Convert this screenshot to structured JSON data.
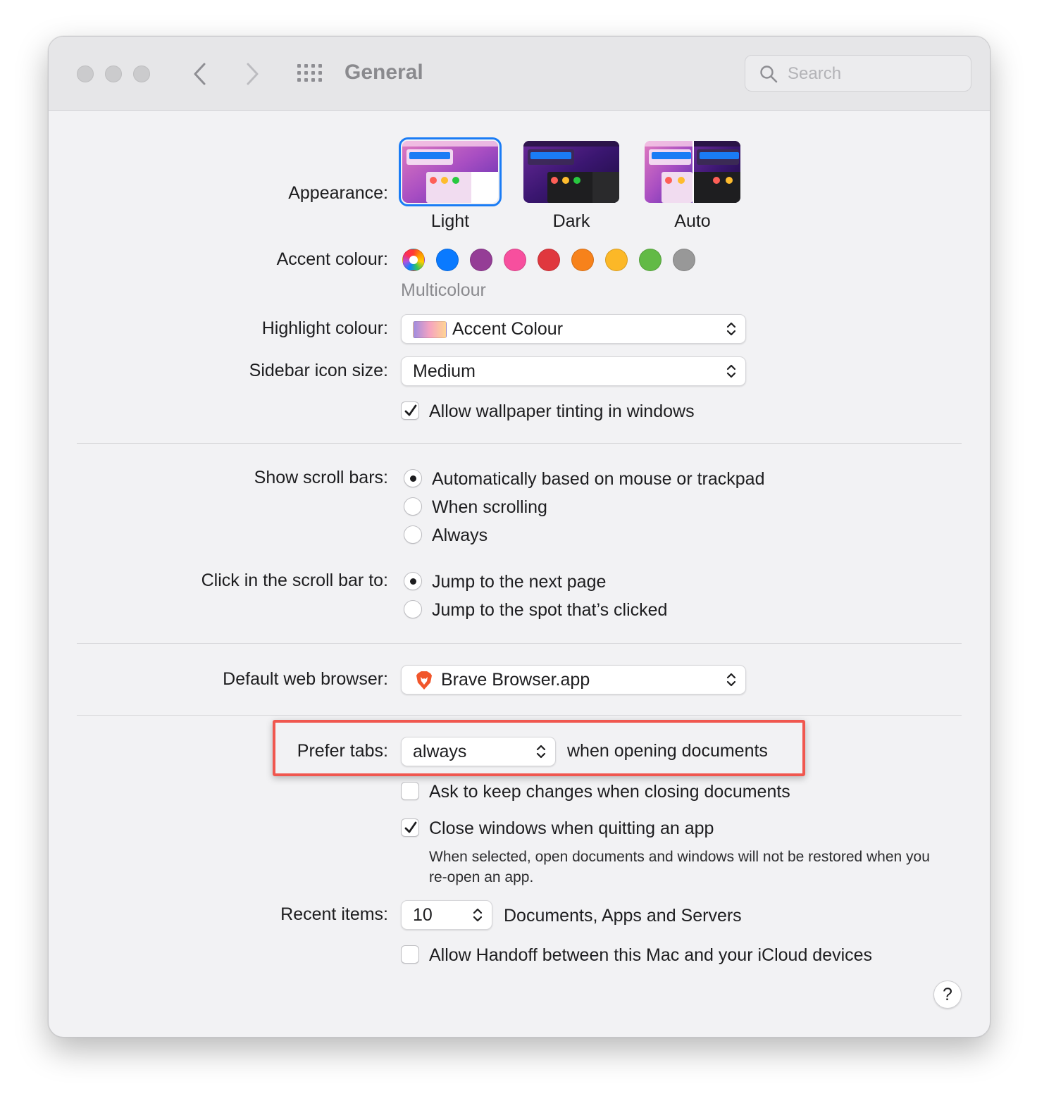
{
  "window": {
    "title": "General",
    "search": {
      "placeholder": "Search",
      "value": ""
    }
  },
  "appearance": {
    "label": "Appearance:",
    "options": [
      "Light",
      "Dark",
      "Auto"
    ],
    "selected": "Light"
  },
  "accent": {
    "label": "Accent colour:",
    "selected_name": "Multicolour",
    "swatches": [
      "multicolour",
      "#0a7aff",
      "#953d96",
      "#f74f9e",
      "#e0383e",
      "#f7821b",
      "#fcb827",
      "#62ba46",
      "#989898"
    ]
  },
  "highlight": {
    "label": "Highlight colour:",
    "value": "Accent Colour"
  },
  "sidebar_icon_size": {
    "label": "Sidebar icon size:",
    "value": "Medium"
  },
  "wallpaper_tinting": {
    "label": "Allow wallpaper tinting in windows",
    "checked": true
  },
  "scroll_bars": {
    "label": "Show scroll bars:",
    "options": [
      "Automatically based on mouse or trackpad",
      "When scrolling",
      "Always"
    ],
    "selected": "Automatically based on mouse or trackpad"
  },
  "scroll_click": {
    "label": "Click in the scroll bar to:",
    "options": [
      "Jump to the next page",
      "Jump to the spot that’s clicked"
    ],
    "selected": "Jump to the next page"
  },
  "default_browser": {
    "label": "Default web browser:",
    "value": "Brave Browser.app"
  },
  "prefer_tabs": {
    "label": "Prefer tabs:",
    "value": "always",
    "suffix": "when opening documents",
    "highlight_color": "#f0574f"
  },
  "ask_keep_changes": {
    "label": "Ask to keep changes when closing documents",
    "checked": false
  },
  "close_windows": {
    "label": "Close windows when quitting an app",
    "checked": true,
    "note": "When selected, open documents and windows will not be restored when you re-open an app."
  },
  "recent_items": {
    "label": "Recent items:",
    "value": "10",
    "suffix": "Documents, Apps and Servers"
  },
  "handoff": {
    "label": "Allow Handoff between this Mac and your iCloud devices",
    "checked": false
  },
  "help": {
    "label": "?"
  }
}
